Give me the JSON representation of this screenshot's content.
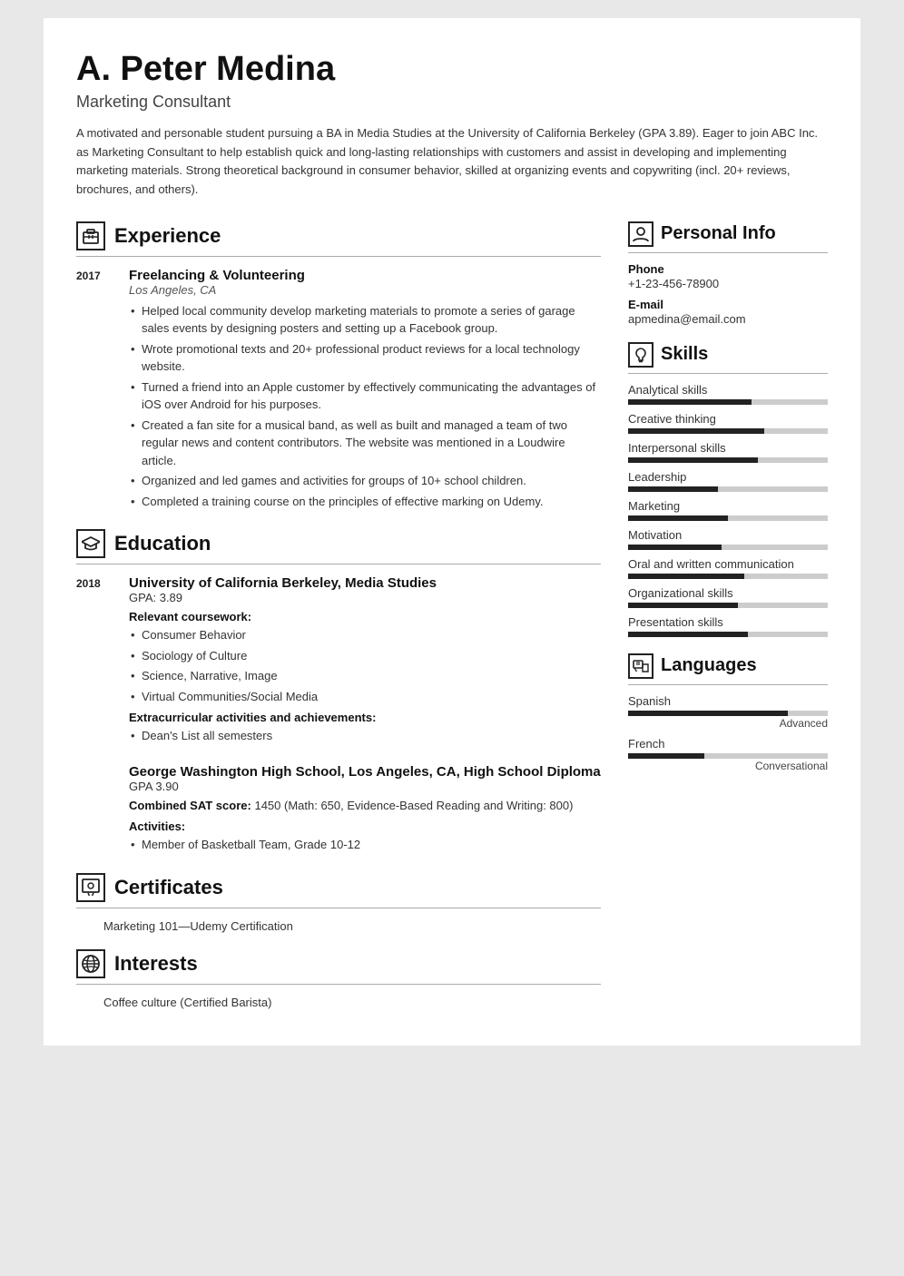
{
  "header": {
    "name": "A. Peter Medina",
    "title": "Marketing Consultant",
    "summary": "A motivated and personable student pursuing a BA in Media Studies at the University of California Berkeley (GPA 3.89). Eager to join ABC Inc. as Marketing Consultant to help establish quick and long-lasting relationships with customers and assist in developing and implementing marketing materials. Strong theoretical background in consumer behavior, skilled at organizing events and copywriting (incl. 20+ reviews, brochures, and others)."
  },
  "sections": {
    "experience": {
      "label": "Experience",
      "entries": [
        {
          "year": "2017",
          "title": "Freelancing & Volunteering",
          "subtitle": "Los Angeles, CA",
          "bullets": [
            "Helped local community develop marketing materials to promote a series of garage sales events by designing posters and setting up a Facebook group.",
            "Wrote promotional texts and 20+ professional product reviews for a local technology website.",
            "Turned a friend into an Apple customer by effectively communicating the advantages of iOS over Android for his purposes.",
            "Created a fan site for a musical band, as well as built and managed a team of two regular news and content contributors. The website was mentioned in a Loudwire article.",
            "Organized and led games and activities for groups of 10+ school children.",
            "Completed a training course on the principles of effective marking on Udemy."
          ]
        }
      ]
    },
    "education": {
      "label": "Education",
      "entries": [
        {
          "year": "2018",
          "title": "University of California Berkeley, Media Studies",
          "subtitle": "",
          "gpa": "GPA: 3.89",
          "coursework_label": "Relevant coursework:",
          "coursework": [
            "Consumer Behavior",
            "Sociology of Culture",
            "Science, Narrative, Image",
            "Virtual Communities/Social Media"
          ],
          "extra_label": "Extracurricular activities and achievements:",
          "extra": [
            "Dean's List all semesters"
          ]
        },
        {
          "year": "",
          "title": "George Washington High School, Los Angeles, CA, High School Diploma",
          "subtitle": "",
          "gpa": "GPA 3.90",
          "sat_label": "Combined SAT score:",
          "sat_value": "1450 (Math: 650, Evidence-Based Reading and Writing: 800)",
          "activities_label": "Activities:",
          "activities": [
            "Member of Basketball Team, Grade 10-12"
          ]
        }
      ]
    },
    "certificates": {
      "label": "Certificates",
      "items": [
        "Marketing 101—Udemy Certification"
      ]
    },
    "interests": {
      "label": "Interests",
      "items": [
        "Coffee culture (Certified Barista)"
      ]
    }
  },
  "right": {
    "personal_info": {
      "label": "Personal Info",
      "phone_label": "Phone",
      "phone": "+1-23-456-78900",
      "email_label": "E-mail",
      "email": "apmedina@email.com"
    },
    "skills": {
      "label": "Skills",
      "items": [
        {
          "name": "Analytical skills",
          "pct": 62
        },
        {
          "name": "Creative thinking",
          "pct": 68
        },
        {
          "name": "Interpersonal skills",
          "pct": 65
        },
        {
          "name": "Leadership",
          "pct": 45
        },
        {
          "name": "Marketing",
          "pct": 50
        },
        {
          "name": "Motivation",
          "pct": 47
        },
        {
          "name": "Oral and written communication",
          "pct": 58
        },
        {
          "name": "Organizational skills",
          "pct": 55
        },
        {
          "name": "Presentation skills",
          "pct": 60
        }
      ]
    },
    "languages": {
      "label": "Languages",
      "items": [
        {
          "name": "Spanish",
          "pct": 80,
          "level": "Advanced"
        },
        {
          "name": "French",
          "pct": 38,
          "level": "Conversational"
        }
      ]
    }
  }
}
